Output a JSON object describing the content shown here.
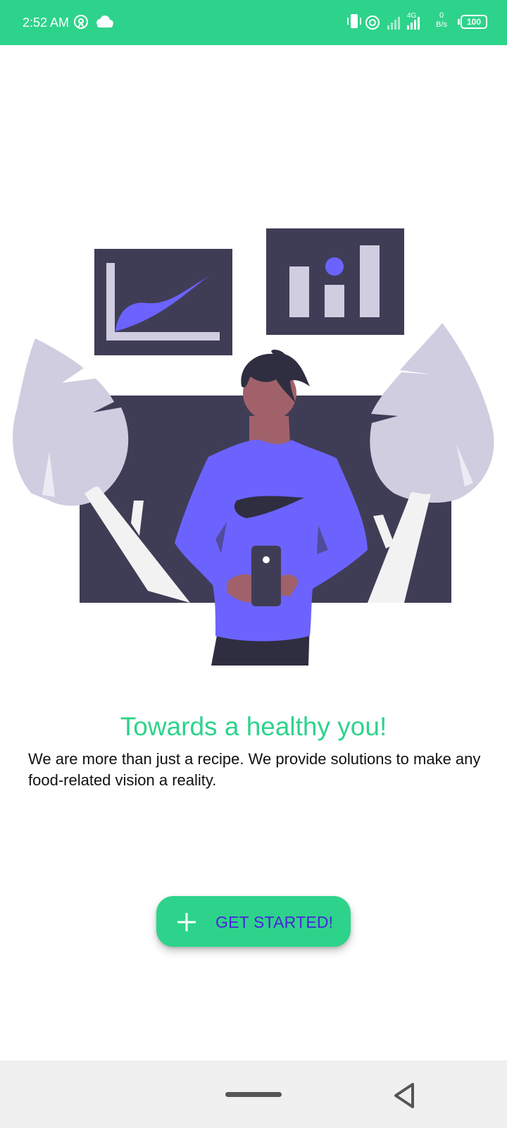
{
  "status_bar": {
    "time": "2:52 AM",
    "left_icons": [
      "hotspot-icon",
      "cloud-icon"
    ],
    "right_icons": [
      "vibrate-icon",
      "wifi-calling-icon",
      "signal-icon",
      "signal-4g-icon"
    ],
    "network_type": "4G",
    "net_speed_value": "0",
    "net_speed_unit": "B/s",
    "battery_level": "100",
    "background_color": "#2ed38b"
  },
  "illustration": {
    "name": "man-with-phone-and-charts",
    "accent_color": "#6c63ff",
    "dark_color": "#3f3d56",
    "leaf_color": "#d0cde1"
  },
  "onboarding": {
    "headline": "Towards a healthy you!",
    "description": "We are more than just a recipe. We provide solutions to make any food-related vision a reality.",
    "headline_color": "#2ed38b"
  },
  "cta": {
    "label": "GET STARTED!",
    "icon": "plus-icon",
    "background_color": "#2ed38b",
    "label_color": "#4b22dc"
  },
  "nav_bar": {
    "items": [
      "home-pill",
      "back-icon"
    ]
  }
}
